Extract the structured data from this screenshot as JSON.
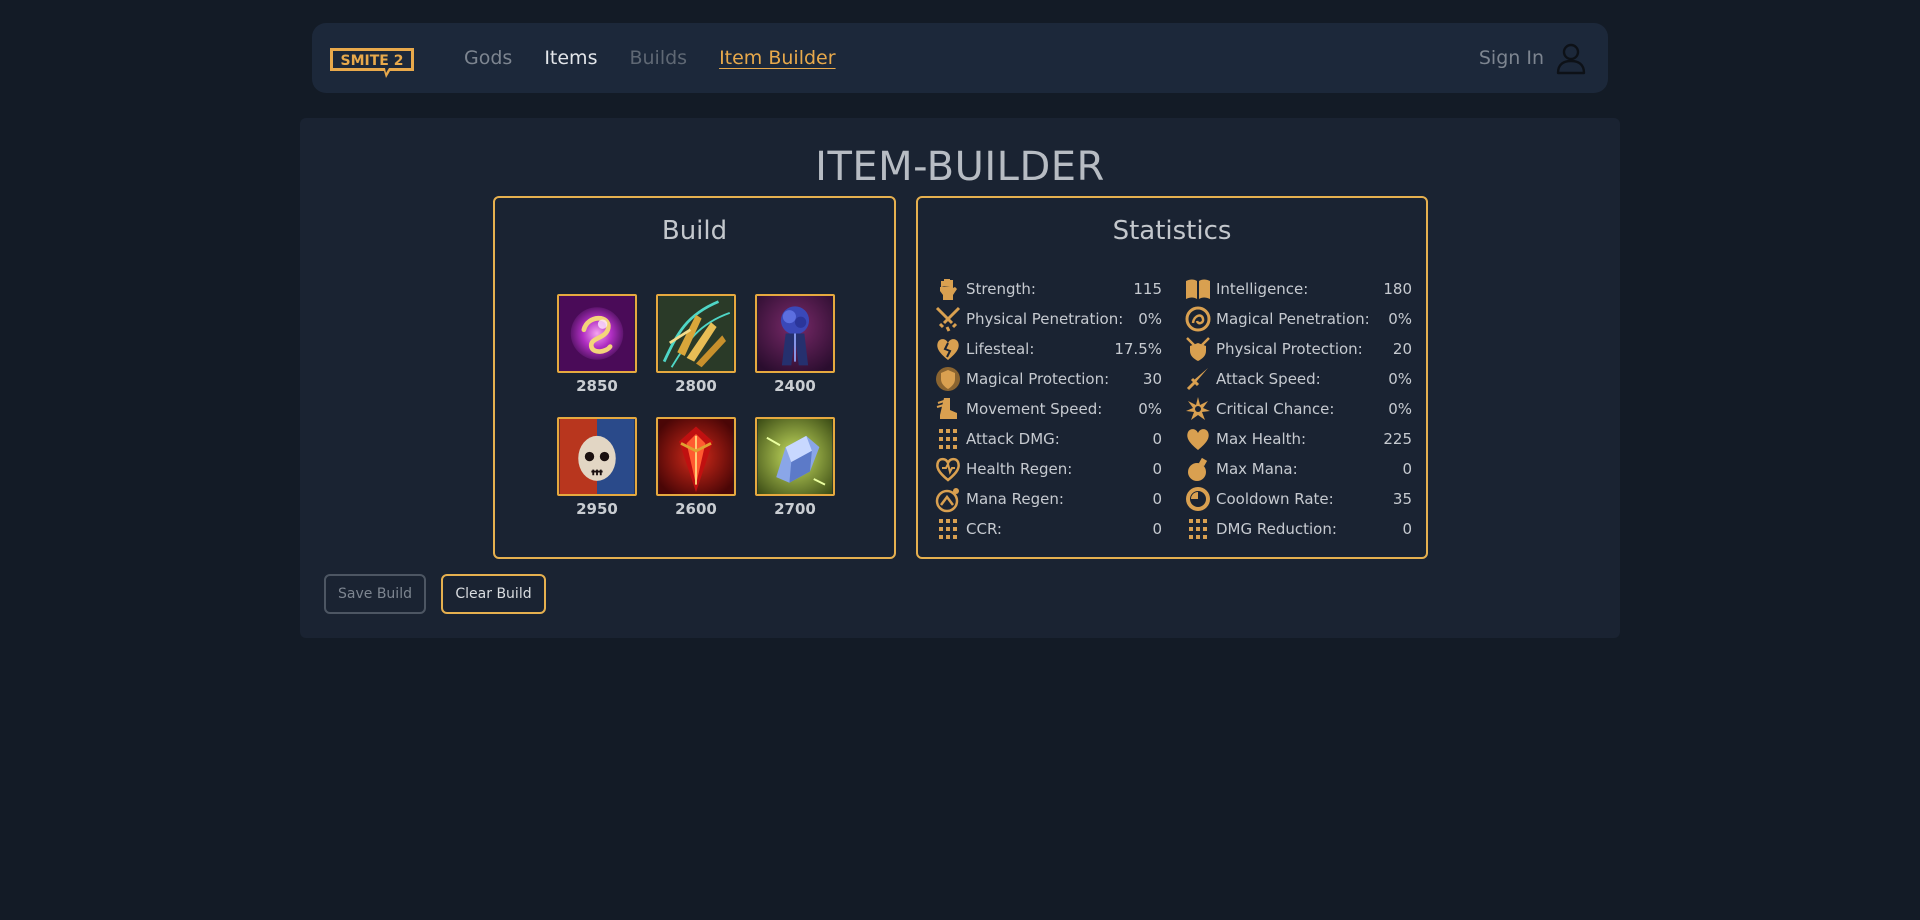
{
  "nav": {
    "logo_text": "SMITE 2",
    "links": [
      "Gods",
      "Items",
      "Builds",
      "Item Builder"
    ],
    "signin_label": "Sign In"
  },
  "page_title": "ITEM-BUILDER",
  "build": {
    "title": "Build",
    "items": [
      {
        "cost": "2850",
        "icon": "purple-orb-item"
      },
      {
        "cost": "2800",
        "icon": "golden-claw-item"
      },
      {
        "cost": "2400",
        "icon": "blue-rose-item"
      },
      {
        "cost": "2950",
        "icon": "skull-mask-item"
      },
      {
        "cost": "2600",
        "icon": "red-blade-item"
      },
      {
        "cost": "2700",
        "icon": "crystal-gauntlet-item"
      }
    ]
  },
  "statistics": {
    "title": "Statistics",
    "left": [
      {
        "label": "Strength:",
        "value": "115",
        "icon": "fist-icon"
      },
      {
        "label": "Physical Penetration:",
        "value": "0%",
        "icon": "crossed-swords-icon"
      },
      {
        "label": "Lifesteal:",
        "value": "17.5%",
        "icon": "broken-heart-icon"
      },
      {
        "label": "Magical Protection:",
        "value": "30",
        "icon": "magic-shield-icon"
      },
      {
        "label": "Movement Speed:",
        "value": "0%",
        "icon": "winged-boot-icon"
      },
      {
        "label": "Attack DMG:",
        "value": "0",
        "icon": "dots-grid-icon"
      },
      {
        "label": "Health Regen:",
        "value": "0",
        "icon": "heart-regen-icon"
      },
      {
        "label": "Mana Regen:",
        "value": "0",
        "icon": "mana-regen-icon"
      },
      {
        "label": "CCR:",
        "value": "0",
        "icon": "dots-grid-icon"
      }
    ],
    "right": [
      {
        "label": "Intelligence:",
        "value": "180",
        "icon": "book-icon"
      },
      {
        "label": "Magical Penetration:",
        "value": "0%",
        "icon": "magic-pen-icon"
      },
      {
        "label": "Physical Protection:",
        "value": "20",
        "icon": "shield-swords-icon"
      },
      {
        "label": "Attack Speed:",
        "value": "0%",
        "icon": "sword-icon"
      },
      {
        "label": "Critical Chance:",
        "value": "0%",
        "icon": "star-burst-icon"
      },
      {
        "label": "Max Health:",
        "value": "225",
        "icon": "heart-icon"
      },
      {
        "label": "Max Mana:",
        "value": "0",
        "icon": "potion-icon"
      },
      {
        "label": "Cooldown Rate:",
        "value": "35",
        "icon": "clock-icon"
      },
      {
        "label": "DMG Reduction:",
        "value": "0",
        "icon": "dots-grid-icon"
      }
    ]
  },
  "buttons": {
    "save": "Save Build",
    "clear": "Clear Build"
  },
  "colors": {
    "background": "#131b26",
    "panel": "#1a2332",
    "accent": "#e6b04f"
  }
}
